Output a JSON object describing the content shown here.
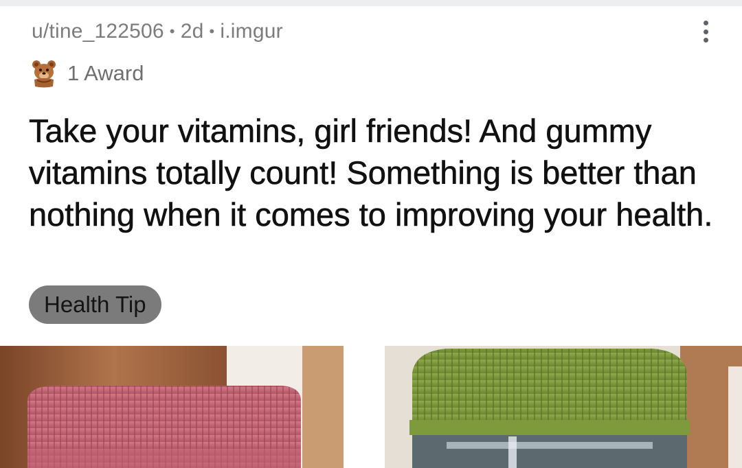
{
  "post": {
    "author": "u/tine_122506",
    "age": "2d",
    "domain": "i.imgur",
    "separator": "•",
    "awards_label": "1 Award",
    "award_icon": "bear-award-icon",
    "title": "Take your vitamins, girl friends! And gummy vitamins totally count! Something is better than nothing when it comes to improving your health.",
    "flair": "Health Tip",
    "more_icon": "more-vertical-icon",
    "image": "vitamin-bottles-photo"
  },
  "colors": {
    "meta_text": "#7c7c7c",
    "title_text": "#111111",
    "flair_bg": "#7b7b7b",
    "pink_lid": "#c46474",
    "green_lid": "#7e9a3c"
  }
}
